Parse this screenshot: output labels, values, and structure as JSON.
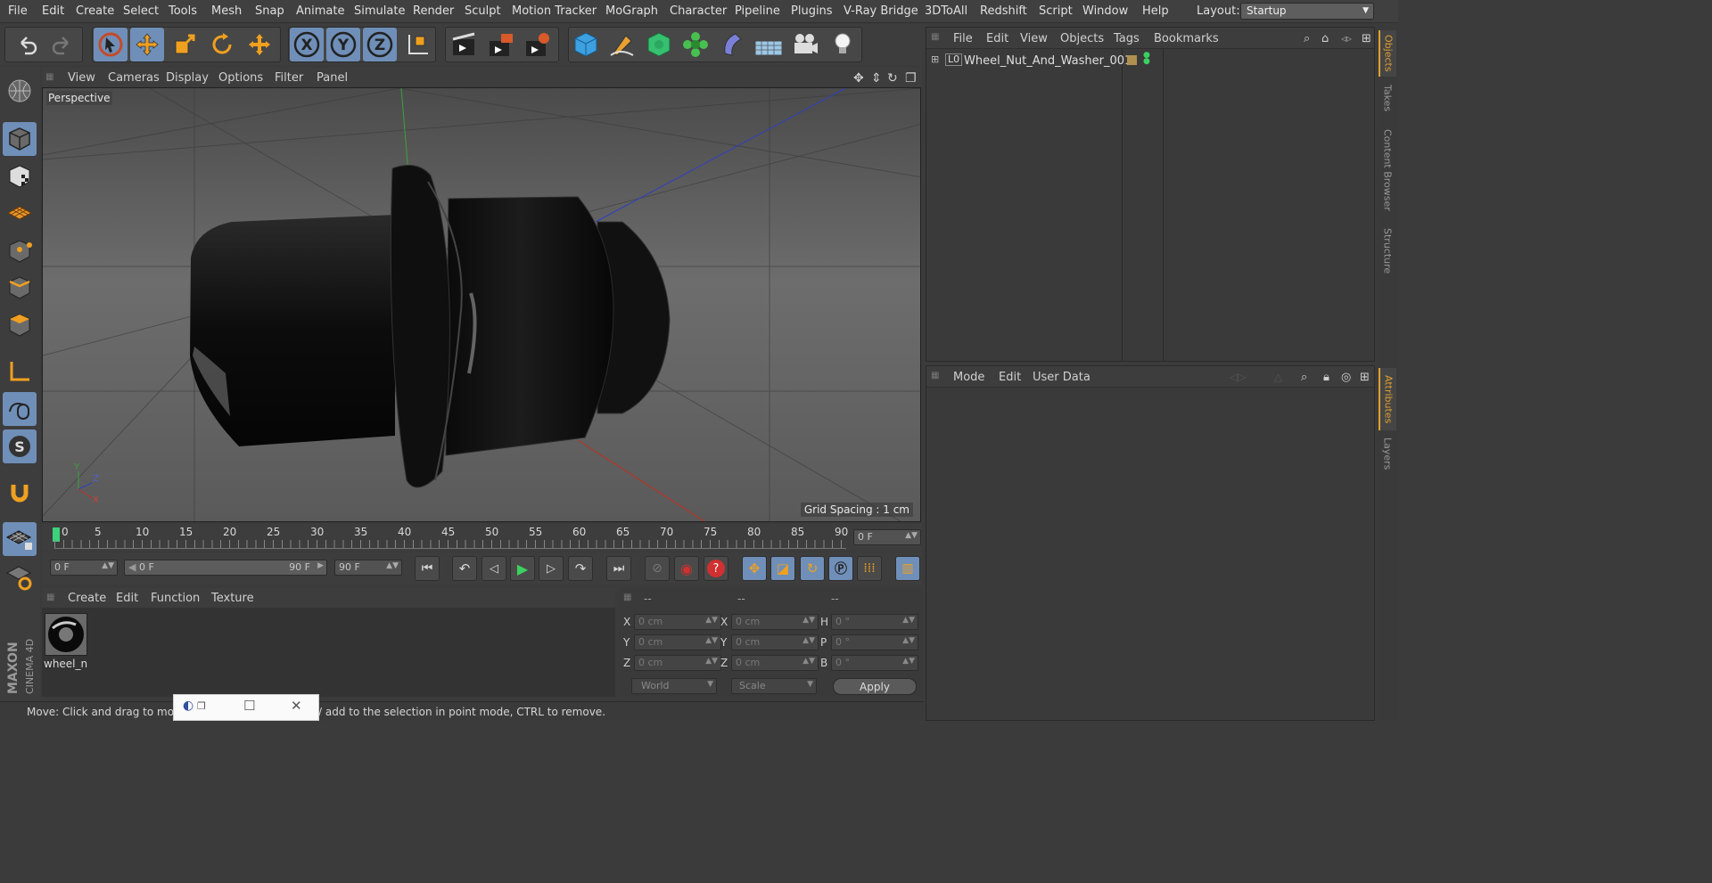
{
  "menubar": {
    "items": [
      "File",
      "Edit",
      "Create",
      "Select",
      "Tools",
      "Mesh",
      "Snap",
      "Animate",
      "Simulate",
      "Render",
      "Sculpt",
      "Motion Tracker",
      "MoGraph",
      "Character",
      "Pipeline",
      "Plugins",
      "V-Ray Bridge",
      "3DToAll",
      "Redshift",
      "Script",
      "Window",
      "Help"
    ],
    "layout_label": "Layout:",
    "layout_value": "Startup"
  },
  "viewport": {
    "menu": [
      "View",
      "Cameras",
      "Display",
      "Options",
      "Filter",
      "Panel"
    ],
    "label": "Perspective",
    "grid_spacing": "Grid Spacing : 1 cm",
    "axis_y": "Y",
    "axis_z": "Z",
    "axis_x": "X"
  },
  "timeline": {
    "ticks": [
      "0",
      "5",
      "10",
      "15",
      "20",
      "25",
      "30",
      "35",
      "40",
      "45",
      "50",
      "55",
      "60",
      "65",
      "70",
      "75",
      "80",
      "85",
      "90"
    ],
    "current_frame": "0 F"
  },
  "playbar": {
    "start_field": "0 F",
    "range_start": "0 F",
    "range_end": "90 F",
    "end_field": "90 F"
  },
  "materials": {
    "menu": [
      "Create",
      "Edit",
      "Function",
      "Texture"
    ],
    "item_label": "wheel_n"
  },
  "coords": {
    "headers": [
      "--",
      "--",
      "--"
    ],
    "rows": [
      {
        "l1": "X",
        "v1": "0 cm",
        "l2": "X",
        "v2": "0 cm",
        "l3": "H",
        "v3": "0 °"
      },
      {
        "l1": "Y",
        "v1": "0 cm",
        "l2": "Y",
        "v2": "0 cm",
        "l3": "P",
        "v3": "0 °"
      },
      {
        "l1": "Z",
        "v1": "0 cm",
        "l2": "Z",
        "v2": "0 cm",
        "l3": "B",
        "v3": "0 °"
      }
    ],
    "mode_select": "World",
    "scale_select": "Scale",
    "apply_label": "Apply"
  },
  "objects": {
    "menu": [
      "File",
      "Edit",
      "View",
      "Objects",
      "Tags",
      "Bookmarks"
    ],
    "tree": [
      {
        "name": "Wheel_Nut_And_Washer_001"
      }
    ]
  },
  "attributes": {
    "menu": [
      "Mode",
      "Edit",
      "User Data"
    ]
  },
  "right_tabs": [
    "Objects",
    "Takes",
    "Content Browser",
    "Structure",
    "Attributes",
    "Layers"
  ],
  "status": {
    "text": "Move: Click and drag to mo                      FT to quantize movement / add to the selection in point mode, CTRL to remove."
  },
  "brand": {
    "line1": "MAXON",
    "line2": "CINEMA 4D"
  },
  "colors": {
    "accent": "#6f8fb8",
    "orange": "#e0a030"
  }
}
